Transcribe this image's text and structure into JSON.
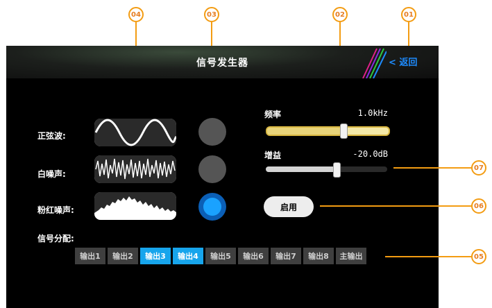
{
  "title": "信号发生器",
  "back_label": "< 返回",
  "waveforms": [
    {
      "label": "正弦波:",
      "icon": "sine-wave-icon",
      "selected": false
    },
    {
      "label": "白噪声:",
      "icon": "white-noise-icon",
      "selected": false
    },
    {
      "label": "粉红噪声:",
      "icon": "pink-noise-icon",
      "selected": true
    }
  ],
  "frequency": {
    "label": "频率",
    "value": "1.0kHz",
    "level": 0.63
  },
  "gain": {
    "label": "增益",
    "value": "-20.0dB",
    "level": 0.58
  },
  "enable_label": "启用",
  "routing_label": "信号分配:",
  "outputs": [
    {
      "label": "输出1",
      "active": false
    },
    {
      "label": "输出2",
      "active": false
    },
    {
      "label": "输出3",
      "active": true
    },
    {
      "label": "输出4",
      "active": true
    },
    {
      "label": "输出5",
      "active": false
    },
    {
      "label": "输出6",
      "active": false
    },
    {
      "label": "输出7",
      "active": false
    },
    {
      "label": "输出8",
      "active": false
    },
    {
      "label": "主输出",
      "active": false
    }
  ],
  "callouts": [
    "01",
    "02",
    "03",
    "04",
    "05",
    "06",
    "07"
  ],
  "colors": {
    "accent": "#17a5ec",
    "callout": "#f39c12",
    "back": "#1e8cff"
  }
}
